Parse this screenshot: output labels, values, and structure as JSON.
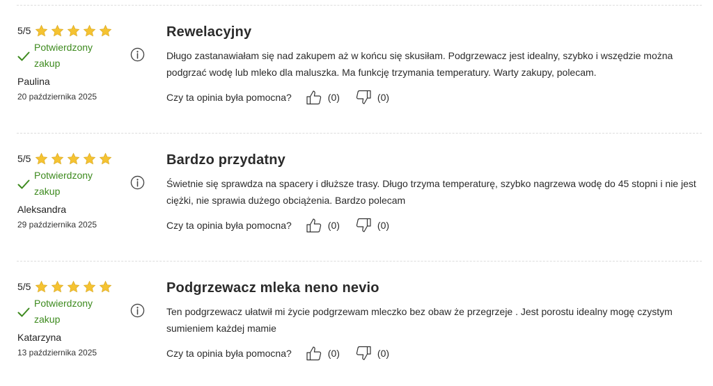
{
  "helpful_question": "Czy ta opinia była pomocna?",
  "verified_label": "Potwierdzony zakup",
  "colors": {
    "verified_green": "#3d8a1e",
    "star_gold": "#f5c332",
    "divider": "#dcdcdc"
  },
  "icons": {
    "star": "star-icon",
    "verified": "check-icon",
    "info": "info-icon",
    "upvote": "thumbs-up-icon",
    "downvote": "thumbs-down-icon"
  },
  "reviews": [
    {
      "score": "5/5",
      "stars": 5,
      "author": "Paulina",
      "date": "20 października 2025",
      "title": "Rewelacyjny",
      "body": "Długo zastanawiałam się nad zakupem aż w końcu się skusiłam. Podgrzewacz jest idealny, szybko i wszędzie można podgrzać wodę lub mleko dla maluszka. Ma funkcję trzymania temperatury. Warty zakupy, polecam.",
      "likes": "(0)",
      "dislikes": "(0)"
    },
    {
      "score": "5/5",
      "stars": 5,
      "author": "Aleksandra",
      "date": "29 października 2025",
      "title": "Bardzo przydatny",
      "body": "Świetnie się sprawdza na spacery i dłuższe trasy. Długo trzyma temperaturę, szybko nagrzewa wodę do 45 stopni i nie jest ciężki, nie sprawia dużego obciążenia. Bardzo polecam",
      "likes": "(0)",
      "dislikes": "(0)"
    },
    {
      "score": "5/5",
      "stars": 5,
      "author": "Katarzyna",
      "date": "13 października 2025",
      "title": "Podgrzewacz mleka neno nevio",
      "body": "Ten podgrzewacz ułatwił mi życie podgrzewam mleczko bez obaw że przegrzeje . Jest porostu idealny mogę czystym sumieniem każdej mamie",
      "likes": "(0)",
      "dislikes": "(0)"
    }
  ]
}
